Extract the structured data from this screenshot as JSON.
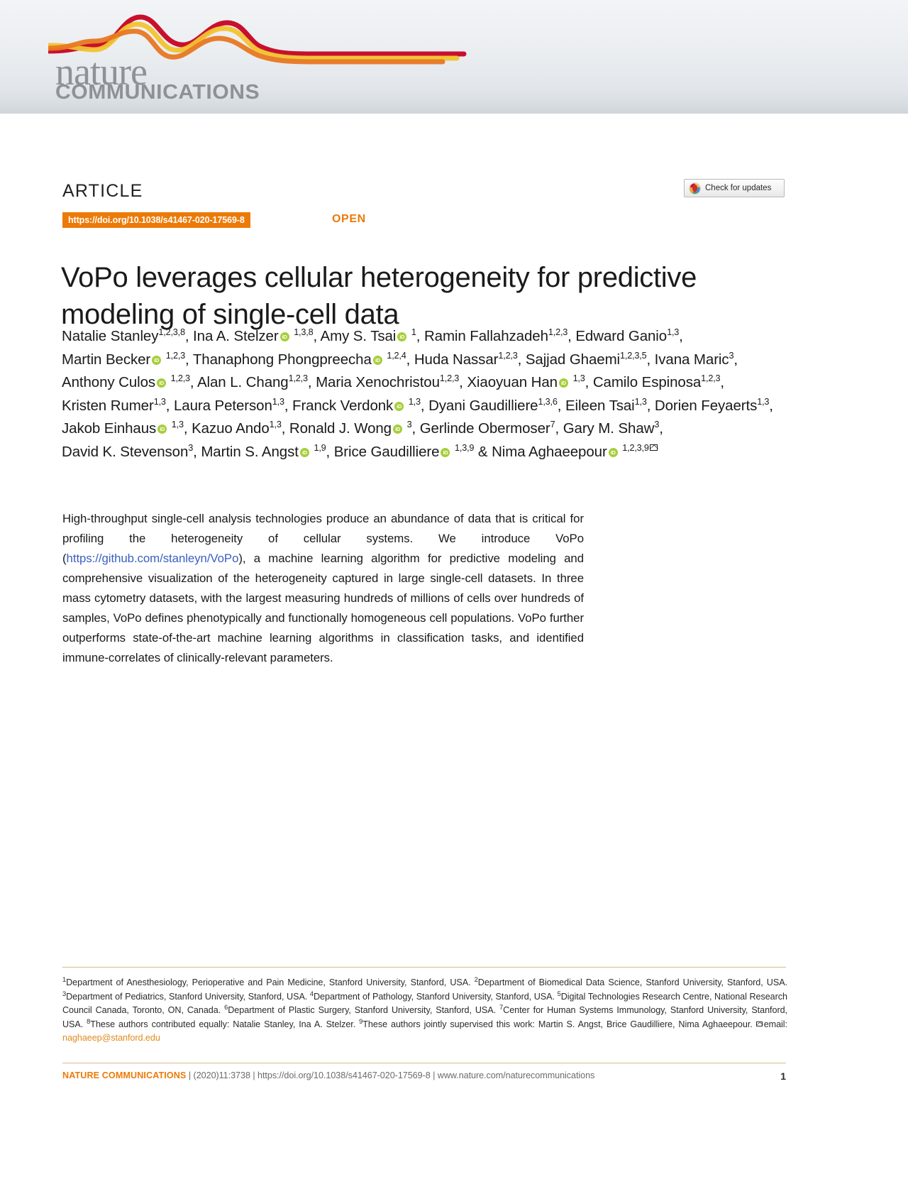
{
  "masthead": {
    "logo_primary": "nature",
    "logo_secondary": "COMMUNICATIONS",
    "wave_colors": [
      "#c8102e",
      "#e8a33d",
      "#f2c230",
      "#e87722"
    ]
  },
  "header": {
    "kicker": "ARTICLE",
    "doi_badge": "https://doi.org/10.1038/s41467-020-17569-8",
    "open_access_label": "OPEN",
    "crossmark_label": "Check for updates",
    "accent_color": "#ec7a08",
    "link_color": "#3b5fc0"
  },
  "title": "VoPo leverages cellular heterogeneity for predictive modeling of single-cell data",
  "authors": {
    "lines": [
      [
        {
          "name": "Natalie Stanley",
          "orcid": false,
          "sup": "1,2,3,8",
          "sep": ", "
        },
        {
          "name": "Ina A. Stelzer",
          "orcid": true,
          "sup": "1,3,8",
          "sep": ", "
        },
        {
          "name": "Amy S. Tsai",
          "orcid": true,
          "sup": "1",
          "sep": ", "
        },
        {
          "name": "Ramin Fallahzadeh",
          "orcid": false,
          "sup": "1,2,3",
          "sep": ", "
        },
        {
          "name": "Edward Ganio",
          "orcid": false,
          "sup": "1,3",
          "sep": ","
        }
      ],
      [
        {
          "name": "Martin Becker",
          "orcid": true,
          "sup": "1,2,3",
          "sep": ", "
        },
        {
          "name": "Thanaphong Phongpreecha",
          "orcid": true,
          "sup": "1,2,4",
          "sep": ", "
        },
        {
          "name": "Huda Nassar",
          "orcid": false,
          "sup": "1,2,3",
          "sep": ", "
        },
        {
          "name": "Sajjad Ghaemi",
          "orcid": false,
          "sup": "1,2,3,5",
          "sep": ", "
        },
        {
          "name": "Ivana Maric",
          "orcid": false,
          "sup": "3",
          "sep": ","
        }
      ],
      [
        {
          "name": "Anthony Culos",
          "orcid": true,
          "sup": "1,2,3",
          "sep": ", "
        },
        {
          "name": "Alan L. Chang",
          "orcid": false,
          "sup": "1,2,3",
          "sep": ", "
        },
        {
          "name": "Maria Xenochristou",
          "orcid": false,
          "sup": "1,2,3",
          "sep": ", "
        },
        {
          "name": "Xiaoyuan Han",
          "orcid": true,
          "sup": "1,3",
          "sep": ", "
        },
        {
          "name": "Camilo Espinosa",
          "orcid": false,
          "sup": "1,2,3",
          "sep": ","
        }
      ],
      [
        {
          "name": "Kristen Rumer",
          "orcid": false,
          "sup": "1,3",
          "sep": ", "
        },
        {
          "name": "Laura Peterson",
          "orcid": false,
          "sup": "1,3",
          "sep": ", "
        },
        {
          "name": "Franck Verdonk",
          "orcid": true,
          "sup": "1,3",
          "sep": ", "
        },
        {
          "name": "Dyani Gaudilliere",
          "orcid": false,
          "sup": "1,3,6",
          "sep": ", "
        },
        {
          "name": "Eileen Tsai",
          "orcid": false,
          "sup": "1,3",
          "sep": ", "
        },
        {
          "name": "Dorien Feyaerts",
          "orcid": false,
          "sup": "1,3",
          "sep": ","
        }
      ],
      [
        {
          "name": "Jakob Einhaus",
          "orcid": true,
          "sup": "1,3",
          "sep": ", "
        },
        {
          "name": "Kazuo Ando",
          "orcid": false,
          "sup": "1,3",
          "sep": ", "
        },
        {
          "name": "Ronald J. Wong",
          "orcid": true,
          "sup": "3",
          "sep": ", "
        },
        {
          "name": "Gerlinde Obermoser",
          "orcid": false,
          "sup": "7",
          "sep": ", "
        },
        {
          "name": "Gary M. Shaw",
          "orcid": false,
          "sup": "3",
          "sep": ","
        }
      ],
      [
        {
          "name": "David K. Stevenson",
          "orcid": false,
          "sup": "3",
          "sep": ", "
        },
        {
          "name": "Martin S. Angst",
          "orcid": true,
          "sup": "1,9",
          "sep": ", "
        },
        {
          "name": "Brice Gaudilliere",
          "orcid": true,
          "sup": "1,3,9",
          "sep": " & "
        },
        {
          "name": "Nima Aghaeepour",
          "orcid": true,
          "sup": "1,2,3,9",
          "envelope": true,
          "sep": ""
        }
      ]
    ],
    "orcid_label": "iD",
    "orcid_color": "#a6ce39"
  },
  "abstract": {
    "part1": "High-throughput single-cell analysis technologies produce an abundance of data that is critical for profiling the heterogeneity of cellular systems. We introduce VoPo (",
    "link_text": "https://github.com/stanleyn/VoPo",
    "part2": "), a machine learning algorithm for predictive modeling and comprehensive visualization of the heterogeneity captured in large single-cell datasets. In three mass cytometry datasets, with the largest measuring hundreds of millions of cells over hundreds of samples, VoPo defines phenotypically and functionally homogeneous cell populations. VoPo further outperforms state-of-the-art machine learning algorithms in classification tasks, and identified immune-correlates of clinically-relevant parameters."
  },
  "affiliations": {
    "entries": [
      {
        "num": "1",
        "text": "Department of Anesthesiology, Perioperative and Pain Medicine, Stanford University, Stanford, USA."
      },
      {
        "num": "2",
        "text": "Department of Biomedical Data Science, Stanford University, Stanford, USA."
      },
      {
        "num": "3",
        "text": "Department of Pediatrics, Stanford University, Stanford, USA."
      },
      {
        "num": "4",
        "text": "Department of Pathology, Stanford University, Stanford, USA."
      },
      {
        "num": "5",
        "text": "Digital Technologies Research Centre, National Research Council Canada, Toronto, ON, Canada."
      },
      {
        "num": "6",
        "text": "Department of Plastic Surgery, Stanford University, Stanford, USA."
      },
      {
        "num": "7",
        "text": "Center for Human Systems Immunology, Stanford University, Stanford, USA."
      },
      {
        "num": "8",
        "text": "These authors contributed equally: Natalie Stanley, Ina A. Stelzer."
      },
      {
        "num": "9",
        "text": "These authors jointly supervised this work: Martin S. Angst, Brice Gaudilliere, Nima Aghaeepour."
      }
    ],
    "email_prefix": "email:",
    "email": "naghaeep@stanford.edu",
    "email_color": "#e08a1e"
  },
  "footer": {
    "brand": "NATURE COMMUNICATIONS",
    "citation": " | (2020)11:3738 | https://doi.org/10.1038/s41467-020-17569-8 | www.nature.com/naturecommunications",
    "page_number": "1"
  }
}
